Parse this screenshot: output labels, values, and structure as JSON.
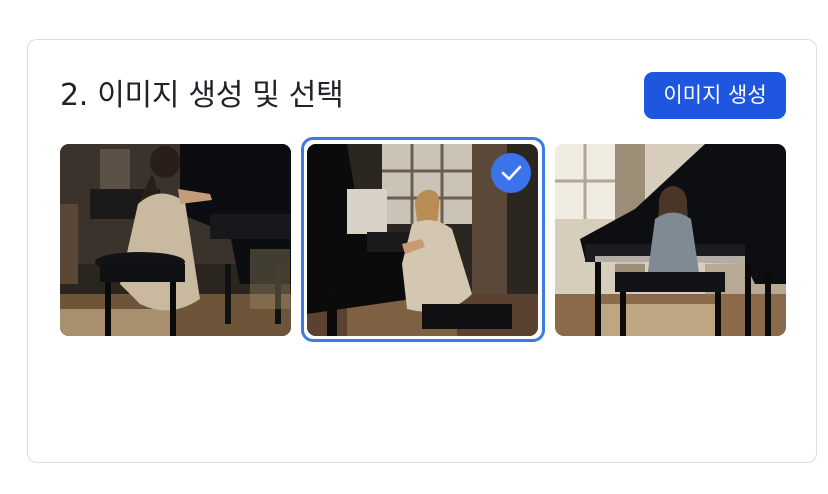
{
  "section": {
    "title": "2. 이미지 생성 및 선택",
    "generate_button_label": "이미지 생성"
  },
  "images": [
    {
      "subject": "woman playing grand piano, back view",
      "selected": false
    },
    {
      "subject": "girl at grand piano looking back",
      "selected": true
    },
    {
      "subject": "girl playing grand piano by window",
      "selected": false
    }
  ],
  "icons": {
    "selected_indicator": "check-icon"
  },
  "colors": {
    "accent": "#1f56e0",
    "selection": "#3c7be6"
  }
}
